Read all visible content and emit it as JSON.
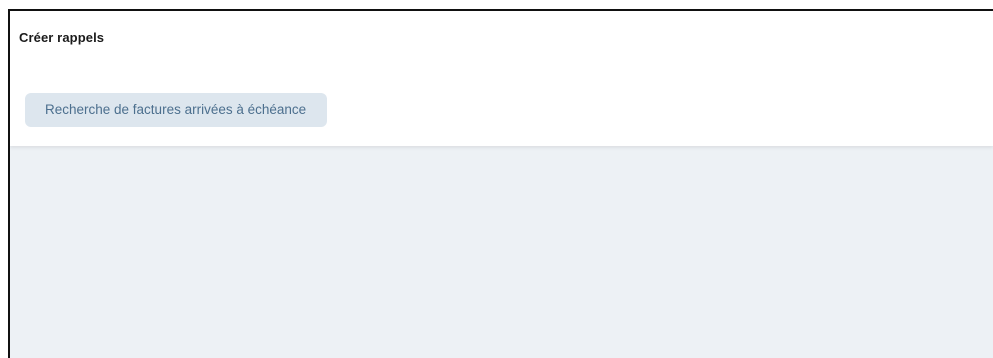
{
  "header": {
    "title": "Créer rappels"
  },
  "actions": {
    "search_due_invoices_label": "Recherche de factures arrivées à échéance"
  },
  "colors": {
    "page_background": "#edf1f5",
    "panel_background": "#ffffff",
    "button_background": "#dde6ee",
    "button_text": "#4c6f8e",
    "title_text": "#1b1b1b"
  }
}
